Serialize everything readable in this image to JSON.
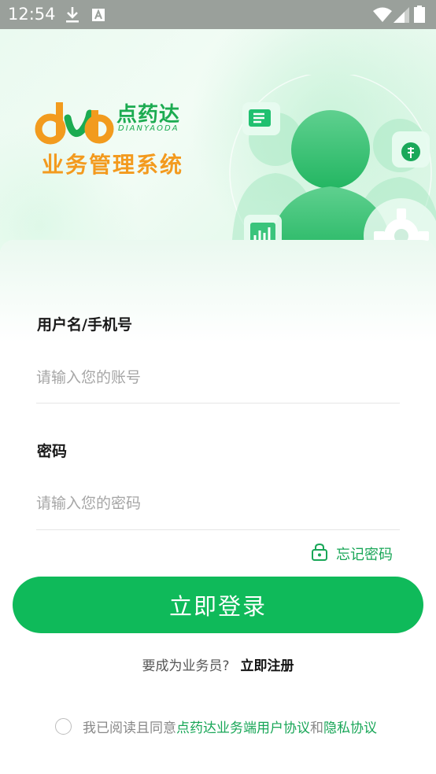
{
  "status_bar": {
    "time": "12:54",
    "icons": [
      "download-icon",
      "a-box-icon",
      "wifi-icon",
      "signal-icon",
      "battery-icon"
    ]
  },
  "header": {
    "logo_letters": "dyd",
    "brand_name": "点药达",
    "brand_latin": "DIANYAODA",
    "subtitle": "业务管理系统",
    "brand_color": "#1cab51",
    "subtitle_color": "#f39a1e"
  },
  "form": {
    "username_label": "用户名/手机号",
    "username_placeholder": "请输入您的账号",
    "password_label": "密码",
    "password_placeholder": "请输入您的密码",
    "forgot_label": "忘记密码",
    "login_label": "立即登录",
    "accent_color": "#0fba5a"
  },
  "register": {
    "question": "要成为业务员?",
    "link": "立即注册"
  },
  "agreement": {
    "prefix": "我已阅读且同意",
    "user_agreement": "点药达业务端用户协议",
    "and": "和",
    "privacy": "隐私协议",
    "checked": false
  }
}
